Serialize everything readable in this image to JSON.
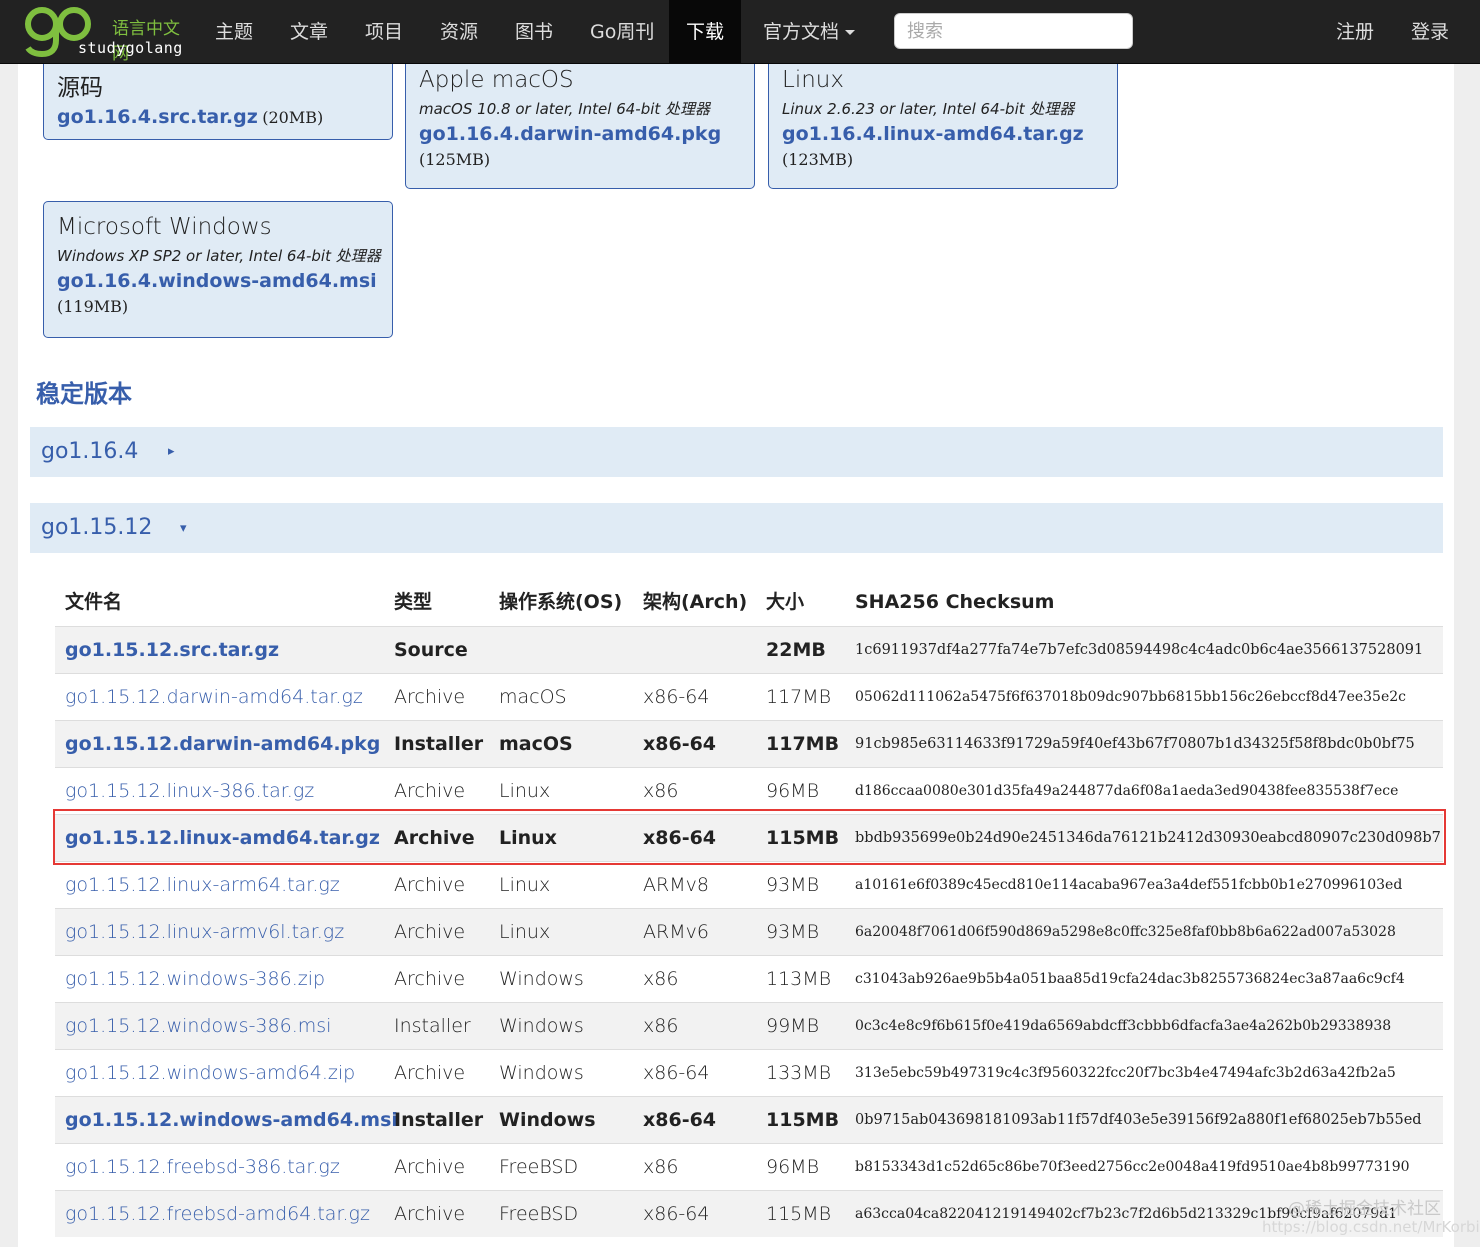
{
  "nav": {
    "logo_cn": "语言中文网",
    "logo_en": "studygolang",
    "items": [
      "主题",
      "文章",
      "项目",
      "资源",
      "图书",
      "Go周刊",
      "下载",
      "官方文档"
    ],
    "active": "下载",
    "search_placeholder": "搜索",
    "register": "注册",
    "login": "登录"
  },
  "cards": {
    "source": {
      "title": "源码",
      "file": "go1.16.4.src.tar.gz",
      "size": "(20MB)"
    },
    "mac": {
      "title": "Apple macOS",
      "desc": "macOS 10.8 or later, Intel 64-bit 处理器",
      "file": "go1.16.4.darwin-amd64.pkg",
      "size": "(125MB)"
    },
    "linux": {
      "title": "Linux",
      "desc": "Linux 2.6.23 or later, Intel 64-bit 处理器",
      "file": "go1.16.4.linux-amd64.tar.gz",
      "size": "(123MB)"
    },
    "windows": {
      "title": "Microsoft Windows",
      "desc": "Windows XP SP2 or later, Intel 64-bit 处理器",
      "file": "go1.16.4.windows-amd64.msi",
      "size": "(119MB)"
    }
  },
  "section_title": "稳定版本",
  "versions": {
    "collapsed": {
      "label": "go1.16.4",
      "arrow": "▸"
    },
    "expanded": {
      "label": "go1.15.12",
      "arrow": "▾"
    }
  },
  "table": {
    "headers": {
      "file": "文件名",
      "kind": "类型",
      "os": "操作系统(OS)",
      "arch": "架构(Arch)",
      "size": "大小",
      "sum": "SHA256 Checksum"
    },
    "rows": [
      {
        "file": "go1.15.12.src.tar.gz",
        "kind": "Source",
        "os": "",
        "arch": "",
        "size": "22MB",
        "sum": "1c6911937df4a277fa74e7b7efc3d08594498c4c4adc0b6c4ae3566137528091",
        "bold": true
      },
      {
        "file": "go1.15.12.darwin-amd64.tar.gz",
        "kind": "Archive",
        "os": "macOS",
        "arch": "x86-64",
        "size": "117MB",
        "sum": "05062d111062a5475f6f637018b09dc907bb6815bb156c26ebccf8d47ee35e2c",
        "bold": false
      },
      {
        "file": "go1.15.12.darwin-amd64.pkg",
        "kind": "Installer",
        "os": "macOS",
        "arch": "x86-64",
        "size": "117MB",
        "sum": "91cb985e63114633f91729a59f40ef43b67f70807b1d34325f58f8bdc0b0bf75",
        "bold": true
      },
      {
        "file": "go1.15.12.linux-386.tar.gz",
        "kind": "Archive",
        "os": "Linux",
        "arch": "x86",
        "size": "96MB",
        "sum": "d186ccaa0080e301d35fa49a244877da6f08a1aeda3ed90438fee835538f7ece",
        "bold": false
      },
      {
        "file": "go1.15.12.linux-amd64.tar.gz",
        "kind": "Archive",
        "os": "Linux",
        "arch": "x86-64",
        "size": "115MB",
        "sum": "bbdb935699e0b24d90e2451346da76121b2412d30930eabcd80907c230d098b7",
        "bold": true
      },
      {
        "file": "go1.15.12.linux-arm64.tar.gz",
        "kind": "Archive",
        "os": "Linux",
        "arch": "ARMv8",
        "size": "93MB",
        "sum": "a10161e6f0389c45ecd810e114acaba967ea3a4def551fcbb0b1e270996103ed",
        "bold": false
      },
      {
        "file": "go1.15.12.linux-armv6l.tar.gz",
        "kind": "Archive",
        "os": "Linux",
        "arch": "ARMv6",
        "size": "93MB",
        "sum": "6a20048f7061d06f590d869a5298e8c0ffc325e8faf0bb8b6a622ad007a53028",
        "bold": false
      },
      {
        "file": "go1.15.12.windows-386.zip",
        "kind": "Archive",
        "os": "Windows",
        "arch": "x86",
        "size": "113MB",
        "sum": "c31043ab926ae9b5b4a051baa85d19cfa24dac3b8255736824ec3a87aa6c9cf4",
        "bold": false
      },
      {
        "file": "go1.15.12.windows-386.msi",
        "kind": "Installer",
        "os": "Windows",
        "arch": "x86",
        "size": "99MB",
        "sum": "0c3c4e8c9f6b615f0e419da6569abdcff3cbbb6dfacfa3ae4a262b0b29338938",
        "bold": false
      },
      {
        "file": "go1.15.12.windows-amd64.zip",
        "kind": "Archive",
        "os": "Windows",
        "arch": "x86-64",
        "size": "133MB",
        "sum": "313e5ebc59b497319c4c3f9560322fcc20f7bc3b4e47494afc3b2d63a42fb2a5",
        "bold": false
      },
      {
        "file": "go1.15.12.windows-amd64.msi",
        "kind": "Installer",
        "os": "Windows",
        "arch": "x86-64",
        "size": "115MB",
        "sum": "0b9715ab043698181093ab11f57df403e5e39156f92a880f1ef68025eb7b55ed",
        "bold": true
      },
      {
        "file": "go1.15.12.freebsd-386.tar.gz",
        "kind": "Archive",
        "os": "FreeBSD",
        "arch": "x86",
        "size": "96MB",
        "sum": "b8153343d1c52d65c86be70f3eed2756cc2e0048a419fd9510ae4b8b99773190",
        "bold": false
      },
      {
        "file": "go1.15.12.freebsd-amd64.tar.gz",
        "kind": "Archive",
        "os": "FreeBSD",
        "arch": "x86-64",
        "size": "115MB",
        "sum": "a63cca04ca822041219149402cf7b23c7f2d6b5d213329c1bf90cf9af62079d1",
        "bold": false
      }
    ],
    "highlighted_row": 4
  },
  "watermark": "@稀土掘金技术社区",
  "watermark2": "https://blog.csdn.net/MrKorbin",
  "colors": {
    "link": "#375eab",
    "card_bg": "#e0ebf5",
    "navbar": "#222222",
    "highlight": "#e53935"
  }
}
